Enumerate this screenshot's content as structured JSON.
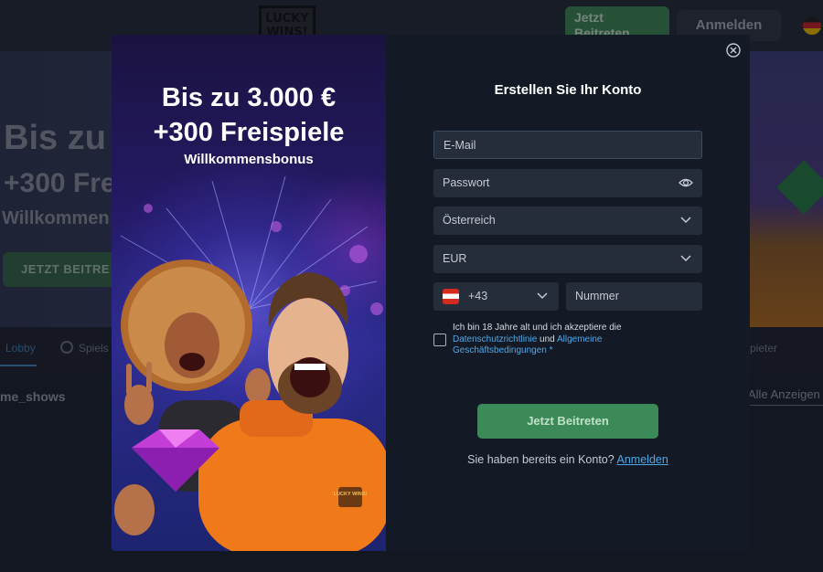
{
  "background": {
    "logo_text": "LUCKY WINS!",
    "join_button": "Jetzt Beitreten",
    "login_button": "Anmelden",
    "hero_title": "Bis zu",
    "hero_subtitle": "+300 Fre",
    "hero_caption": "Willkommen",
    "hero_button": "JETZT BEITRE",
    "tab_lobby": "Lobby",
    "tab_games": "Spiels",
    "tab_right": "pieter",
    "section_title": "me_shows",
    "show_all": "Alle Anzeigen"
  },
  "promo": {
    "title_line1": "Bis zu 3.000 €",
    "title_line2": "+300 Freispiele",
    "subtitle": "Willkommensbonus",
    "shirt_logo": "LUCKY WINS!"
  },
  "form": {
    "title": "Erstellen Sie Ihr Konto",
    "email_placeholder": "E-Mail",
    "password_placeholder": "Passwort",
    "country_value": "Österreich",
    "currency_value": "EUR",
    "phone_code": "+43",
    "phone_placeholder": "Nummer",
    "terms_text_1": "Ich bin 18 Jahre alt und ich akzeptiere die ",
    "terms_link_privacy": "Datenschutzrichtlinie",
    "terms_text_2": " und ",
    "terms_link_terms": "Allgemeine Geschäftsbedingungen",
    "terms_required": " *",
    "submit_button": "Jetzt Beitreten",
    "login_prompt": "Sie haben bereits ein Konto?",
    "login_link": "Anmelden"
  },
  "colors": {
    "accent_green": "#3b8a57",
    "link_blue": "#4ea7e6",
    "panel_bg": "#141a25",
    "field_bg": "#252d3b"
  },
  "icons": [
    "close-icon",
    "eye-icon",
    "chevron-down-icon",
    "austria-flag-icon",
    "germany-flag-icon"
  ]
}
